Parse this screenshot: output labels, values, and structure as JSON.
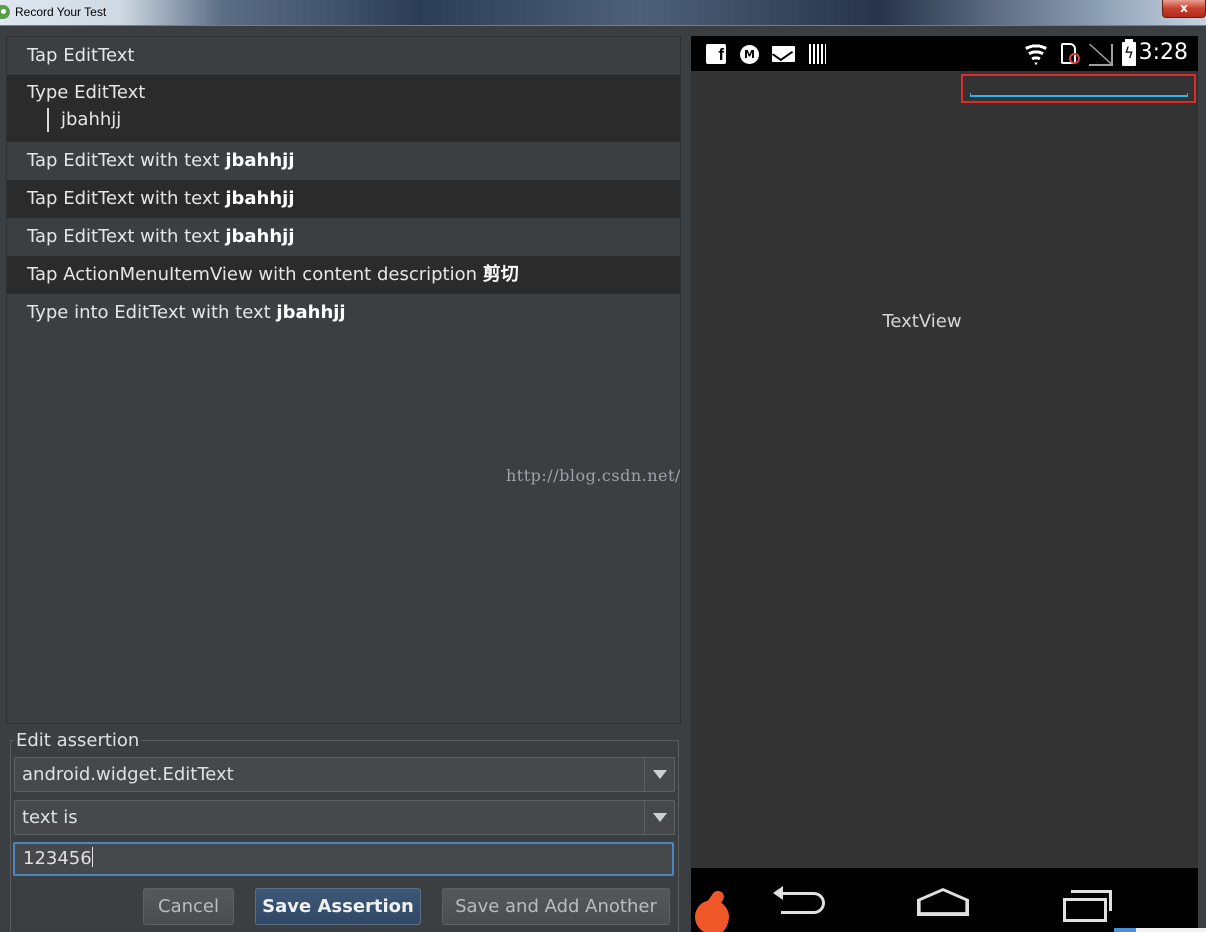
{
  "window": {
    "title": "Record Your Test",
    "close_label": "x"
  },
  "events": [
    {
      "prefix": "Tap EditText",
      "bold": ""
    },
    {
      "prefix": "Type EditText",
      "bold": "",
      "value": "jbahhjj"
    },
    {
      "prefix": "Tap EditText with text ",
      "bold": "jbahhjj"
    },
    {
      "prefix": "Tap EditText with text ",
      "bold": "jbahhjj"
    },
    {
      "prefix": "Tap EditText with text ",
      "bold": "jbahhjj"
    },
    {
      "prefix": "Tap ActionMenuItemView with content description ",
      "bold": "剪切"
    },
    {
      "prefix": "Type into EditText with text ",
      "bold": "jbahhjj"
    }
  ],
  "watermark": "http://blog.csdn.net/",
  "assertion": {
    "legend": "Edit assertion",
    "element_value": "android.widget.EditText",
    "condition_value": "text is",
    "text_value": "123456",
    "cancel_label": "Cancel",
    "save_label": "Save Assertion",
    "save_add_label": "Save and Add Another"
  },
  "device": {
    "clock": "3:28",
    "fb_glyph": "f",
    "moto_glyph": "M",
    "textview_label": "TextView"
  },
  "colors": {
    "panel_bg": "#3c3f41",
    "row_alt_bg": "#2b2b2b",
    "focus_border": "#4e85c1",
    "primary_button": "#2f4866",
    "highlight_box": "#e02a2a",
    "edittext_underline": "#33b5e5",
    "recorder_accent": "#f0582a"
  }
}
